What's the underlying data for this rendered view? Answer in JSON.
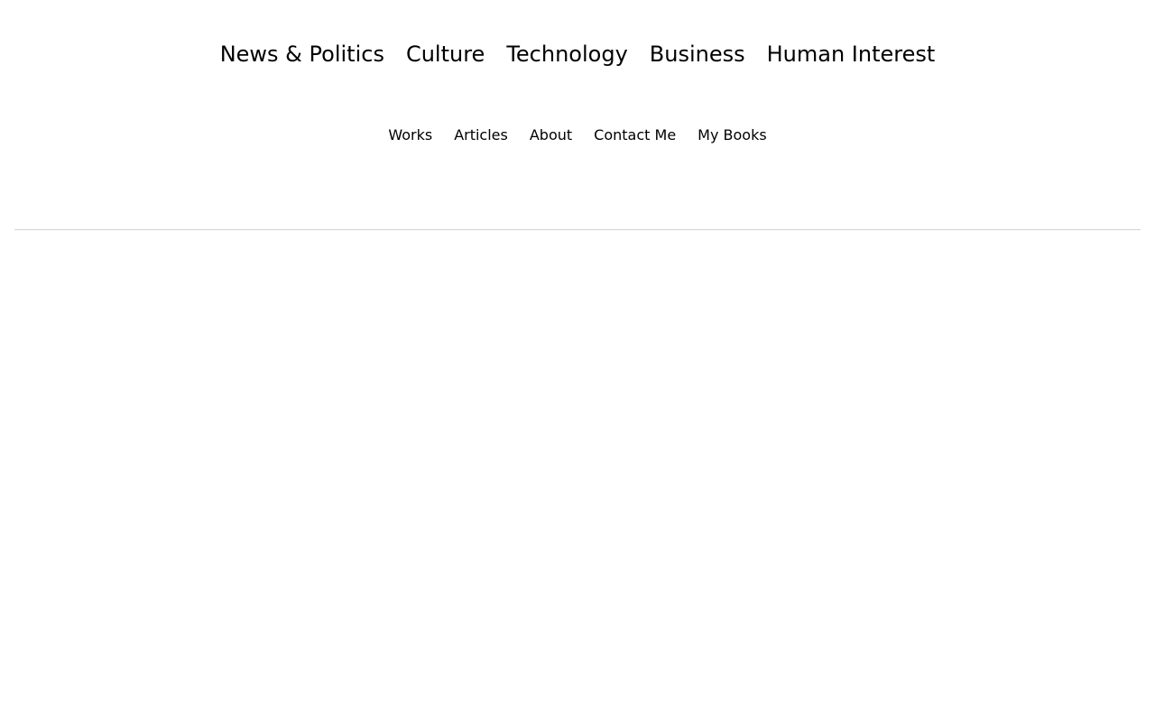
{
  "category_nav": {
    "items": [
      {
        "label": "News & Politics"
      },
      {
        "label": "Culture"
      },
      {
        "label": "Technology"
      },
      {
        "label": "Business"
      },
      {
        "label": "Human Interest"
      }
    ]
  },
  "site_nav": {
    "items": [
      {
        "label": "Works"
      },
      {
        "label": "Articles"
      },
      {
        "label": "About"
      },
      {
        "label": "Contact Me"
      },
      {
        "label": "My Books"
      }
    ]
  },
  "colors": {
    "text": "#000000",
    "background": "#ffffff",
    "divider": "#d3d3d3"
  }
}
